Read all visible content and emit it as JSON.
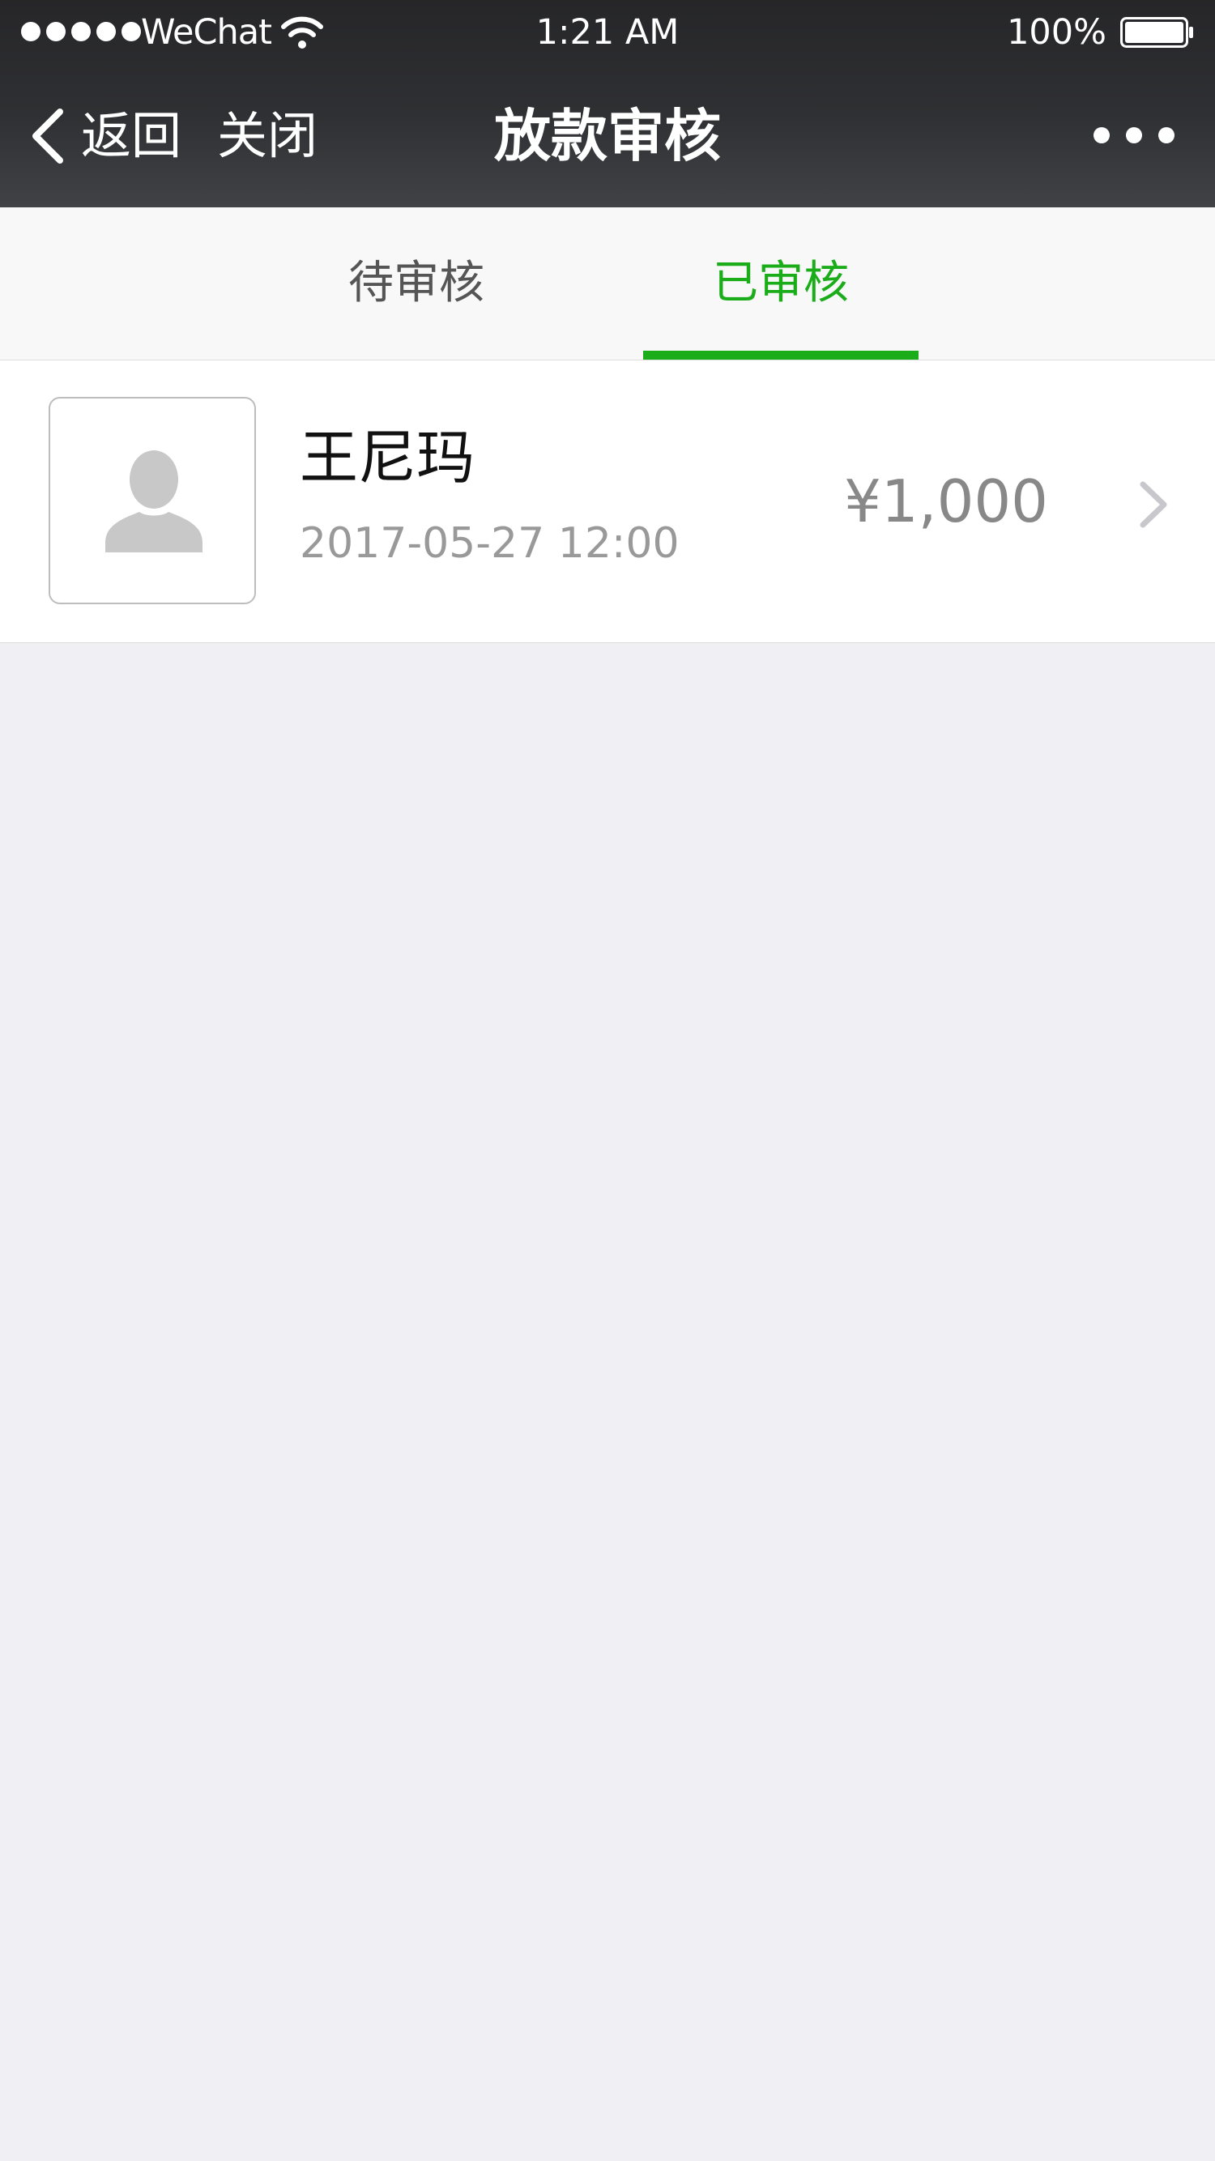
{
  "status_bar": {
    "carrier": "WeChat",
    "time": "1:21 AM",
    "battery_percent": "100%",
    "signal_bars": 5,
    "icons": [
      "signal-dots",
      "wifi-icon",
      "battery-icon"
    ]
  },
  "nav": {
    "back_label": "返回",
    "close_label": "关闭",
    "title": "放款审核",
    "more_icon": "more-icon"
  },
  "tabs": [
    {
      "label": "待审核",
      "active": false
    },
    {
      "label": "已审核",
      "active": true
    }
  ],
  "colors": {
    "accent": "#1aad19",
    "nav_background": "#2f3033",
    "page_background": "#efeff4",
    "tab_inactive_text": "#555555",
    "secondary_text": "#999999",
    "amount_text": "#888888"
  },
  "list": {
    "items": [
      {
        "avatar_icon": "user-placeholder-icon",
        "name": "王尼玛",
        "time": "2017-05-27 12:00",
        "amount": "¥1,000",
        "chevron_icon": "chevron-right-icon"
      }
    ]
  }
}
